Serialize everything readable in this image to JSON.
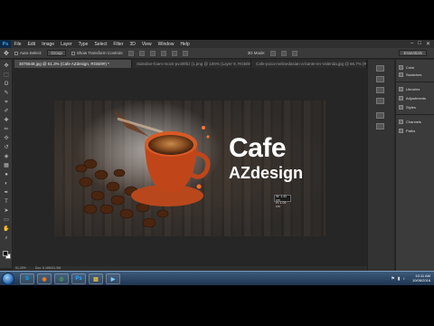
{
  "app": {
    "logo": "Ps"
  },
  "menu": [
    "File",
    "Edit",
    "Image",
    "Layer",
    "Type",
    "Select",
    "Filter",
    "3D",
    "View",
    "Window",
    "Help"
  ],
  "window_controls": {
    "minimize": "–",
    "restore": "□",
    "close": "✕"
  },
  "options_bar": {
    "auto_select_label": "Auto-Select:",
    "auto_select_value": "Group",
    "transform_label": "Show Transform Controls",
    "mode_3d_label": "3D Mode:",
    "workspace": "Essentials"
  },
  "tabs": [
    {
      "label": "3075548.jpg @ 51.3% (Cafe  AZdesign, RGB/8#) *",
      "active": true
    },
    {
      "label": "Sidedine-foam-mock-pvol9fit.l (1.png @ 100% (Layer 9, RGB/8#)",
      "active": false
    },
    {
      "label": "Cafe-poca-melinedasian-a-bante-en-Valenda.jpg @ 66.7% (RGB",
      "active": false
    }
  ],
  "tools": [
    "move-icon",
    "marquee-icon",
    "lasso-icon",
    "quick-select-icon",
    "crop-icon",
    "eyedropper-icon",
    "healing-icon",
    "brush-icon",
    "clone-icon",
    "history-brush-icon",
    "eraser-icon",
    "gradient-icon",
    "blur-icon",
    "dodge-icon",
    "pen-icon",
    "type-icon",
    "path-select-icon",
    "shape-icon",
    "hand-icon",
    "zoom-icon"
  ],
  "tool_glyphs": [
    "✥",
    "⬚",
    "ʘ",
    "✎",
    "⌗",
    "✐",
    "✚",
    "✏",
    "✣",
    "↺",
    "◈",
    "▦",
    "●",
    "◐",
    "✒",
    "T",
    "➤",
    "▭",
    "✋",
    "⌕"
  ],
  "canvas": {
    "title": "Cafe",
    "subtitle": "AZdesign",
    "measure": [
      "W: 1.40 cm",
      "H: 1.09 cm"
    ]
  },
  "status": {
    "zoom": "51.25%",
    "doc": "Doc: 6.18M/11.9M"
  },
  "panels": {
    "group1": [
      "Color",
      "Swatches"
    ],
    "group2": [
      "Libraries",
      "Adjustments",
      "Styles"
    ],
    "group3": [
      "Channels",
      "Paths"
    ]
  },
  "taskbar": {
    "apps": [
      {
        "name": "skype",
        "glyph": "S",
        "color": "#00aff0"
      },
      {
        "name": "firefox",
        "glyph": "◉",
        "color": "#ff7a1a"
      },
      {
        "name": "chrome",
        "glyph": "◎",
        "color": "#4caf50"
      },
      {
        "name": "photoshop",
        "glyph": "Ps",
        "color": "#31a8ff"
      },
      {
        "name": "explorer",
        "glyph": "▤",
        "color": "#f4c542"
      },
      {
        "name": "media",
        "glyph": "▶",
        "color": "#7ec8ff"
      }
    ],
    "time": "10:11 AM",
    "date": "10/08/2016"
  },
  "colors": {
    "accent": "#31a8ff",
    "canvas_text": "#ffffff"
  }
}
